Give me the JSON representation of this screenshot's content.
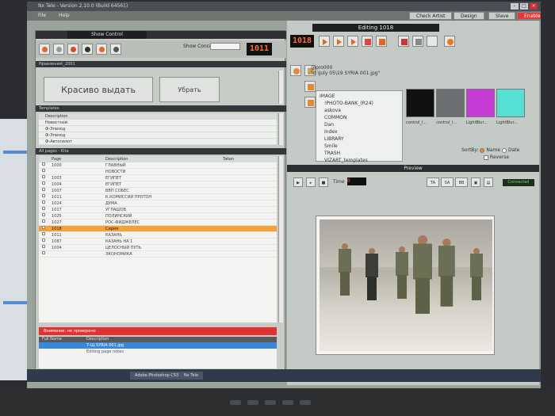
{
  "window": {
    "title": "Nx Tele - Version 2.10.0 (Build 64561)",
    "menu": [
      "File",
      "Help"
    ],
    "top_buttons": [
      "Check Artist",
      "Design",
      "Slave",
      "Enable"
    ]
  },
  "left_panel": {
    "show_control": "Show Control",
    "show_concept_label": "Show Concept:",
    "counter": "1011",
    "section_main": "Нравления\\_2001",
    "button_show": "Красиво выдать",
    "button_remove": "Убрать",
    "templates_title": "Templates",
    "templates_header": "Description",
    "templates": [
      "Новостной",
      "Ф-Эпизод",
      "Ф-Эпизод",
      "Ф-Автопилот"
    ],
    "grid_title": "All pages - Kita",
    "grid_columns": [
      "Page",
      "Description",
      "Taken"
    ],
    "rows": [
      {
        "page": "1000",
        "desc": "ГЛАВНЫЙ"
      },
      {
        "page": "",
        "desc": "НОВОСТИ"
      },
      {
        "page": "1003",
        "desc": "ЕГИПЕТ"
      },
      {
        "page": "1004",
        "desc": "ЕГИПЕТ"
      },
      {
        "page": "1007",
        "desc": "ВВП СОБЕС"
      },
      {
        "page": "1011",
        "desc": "К.КОМИССИИ ПРОТОН"
      },
      {
        "page": "1024",
        "desc": "ДУМА"
      },
      {
        "page": "1017",
        "desc": "УГЛАШОВ"
      },
      {
        "page": "1025",
        "desc": "ПОЛИНСКИЙ"
      },
      {
        "page": "1027",
        "desc": "РОС-ФИДЖЕЛЕС"
      },
      {
        "page": "1018",
        "desc": "Сирия"
      },
      {
        "page": "1011",
        "desc": "КАЗАНЬ"
      },
      {
        "page": "1087",
        "desc": "КАЗАНЬ НА 1"
      },
      {
        "page": "1004",
        "desc": "ЦЕЛОСНЫЙ ПУТЬ"
      },
      {
        "page": "",
        "desc": "ЭКОНОМИКА"
      }
    ],
    "alert_text": "Внимание: не проверено",
    "playout_header": [
      "Full Name",
      "Description"
    ],
    "playout_row": "7-Щ SYRIA 001.jpg",
    "playout_row2": "Editing page notes"
  },
  "right_panel": {
    "editing_title": "Editing 1018",
    "counter": "1018",
    "file_id": "@pro000",
    "file_path": "\"d:\\July 05\\19 SYRIA 001.jpg\"",
    "tree": [
      "IMAGE",
      "!PHOTO-BANK_(R24)",
      "askova",
      "COMMON",
      "Dan",
      "Index",
      "LIBRARY",
      "Smile",
      "TRASH",
      "VIZART_templates"
    ],
    "thumbs": [
      {
        "label": "control_l...",
        "color": "#111111"
      },
      {
        "label": "control_l...",
        "color": "#6c6f72"
      },
      {
        "label": "LightBlur...",
        "color": "#c63ad6"
      },
      {
        "label": "LightBlur...",
        "color": "#55e0d3"
      }
    ],
    "sortby_label": "SortBy:",
    "sort_name": "Name",
    "sort_date": "Date",
    "sort_reverse": "Reverse",
    "preview_title": "Preview",
    "time_label": "Time",
    "time_value": "0",
    "status": "Connected",
    "btn_ta": "TA",
    "btn_sa": "SA",
    "btn_bb": "BB"
  },
  "taskbar": {
    "items": [
      "Adobe Photoshop CS3",
      "Nx Tele"
    ]
  }
}
